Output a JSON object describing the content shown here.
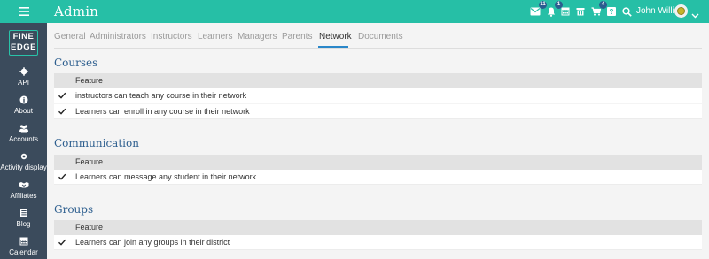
{
  "header": {
    "title": "Admin",
    "user_name": "John Willis",
    "badges": {
      "messages": "11",
      "notifications": "1",
      "cart": "4"
    },
    "icons": [
      "menu-icon",
      "mail-icon",
      "bell-icon",
      "calendar-icon",
      "trash-icon",
      "cart-icon",
      "help-icon",
      "search-icon",
      "chevron-down-icon"
    ]
  },
  "sidebar": {
    "logo_line1": "FINE",
    "logo_line2": "EDGE",
    "items": [
      {
        "label": "API",
        "icon": "gear-icon"
      },
      {
        "label": "About",
        "icon": "info-icon"
      },
      {
        "label": "Accounts",
        "icon": "users-icon"
      },
      {
        "label": "Activity display",
        "icon": "activity-icon"
      },
      {
        "label": "Affiliates",
        "icon": "handshake-icon"
      },
      {
        "label": "Blog",
        "icon": "blog-icon"
      },
      {
        "label": "Calendar",
        "icon": "calendar-icon"
      }
    ]
  },
  "tabs": [
    "General",
    "Administrators",
    "Instructors",
    "Learners",
    "Managers",
    "Parents",
    "Network",
    "Documents"
  ],
  "active_tab": "Network",
  "sections": [
    {
      "title": "Courses",
      "header": "Feature",
      "rows": [
        {
          "label": "instructors can teach any course in their network",
          "checked": true
        },
        {
          "label": "Learners can enroll in any course in their network",
          "checked": true
        }
      ]
    },
    {
      "title": "Communication",
      "header": "Feature",
      "rows": [
        {
          "label": "Learners can message any student in their network",
          "checked": true
        }
      ]
    },
    {
      "title": "Groups",
      "header": "Feature",
      "rows": [
        {
          "label": "Learners can join any groups in their district",
          "checked": true
        }
      ]
    }
  ],
  "colors": {
    "topbar": "#26bfa6",
    "sidebar": "#3b4b5c",
    "accent": "#2a87c9",
    "section_title": "#2e5f8f"
  }
}
